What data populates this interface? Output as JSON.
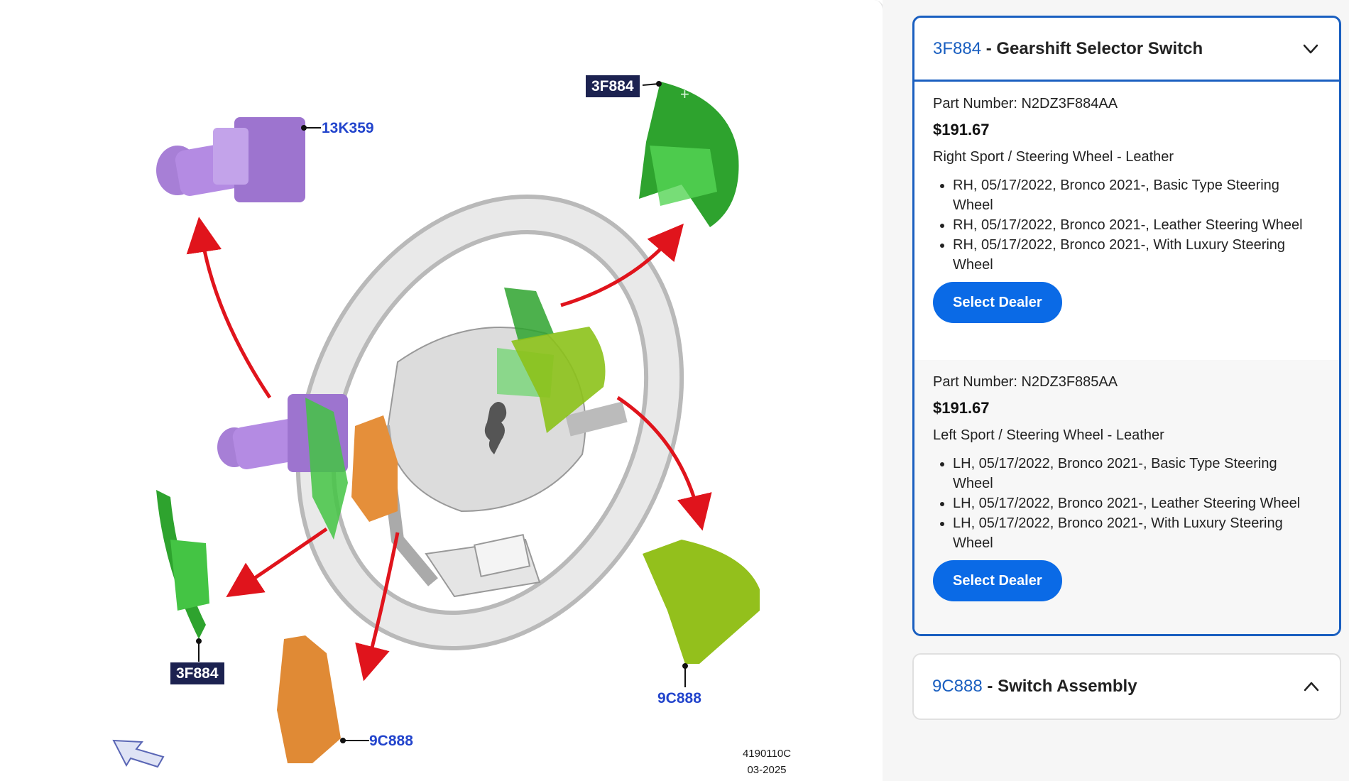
{
  "diagram": {
    "callouts": {
      "top_left_label": "13K359",
      "top_right_label": "3F884",
      "bottom_left_label": "3F884",
      "bottom_mid_label": "9C888",
      "bottom_right_label": "9C888"
    },
    "drawing_id": "4190110C",
    "drawing_date": "03-2025"
  },
  "parts_panel": {
    "expanded_section": {
      "code": "3F884",
      "separator": " - ",
      "title": "Gearshift Selector Switch",
      "parts": [
        {
          "part_number": "Part Number: N2DZ3F884AA",
          "price": "$191.67",
          "description": "Right Sport / Steering Wheel - Leather",
          "applications": [
            "RH, 05/17/2022, Bronco 2021-, Basic Type Steering Wheel",
            "RH, 05/17/2022, Bronco 2021-, Leather Steering Wheel",
            "RH, 05/17/2022, Bronco 2021-, With Luxury Steering Wheel"
          ],
          "button_label": "Select Dealer"
        },
        {
          "part_number": "Part Number: N2DZ3F885AA",
          "price": "$191.67",
          "description": "Left Sport / Steering Wheel - Leather",
          "applications": [
            "LH, 05/17/2022, Bronco 2021-, Basic Type Steering Wheel",
            "LH, 05/17/2022, Bronco 2021-, Leather Steering Wheel",
            "LH, 05/17/2022, Bronco 2021-, With Luxury Steering Wheel"
          ],
          "button_label": "Select Dealer"
        }
      ]
    },
    "collapsed_section": {
      "code": "9C888",
      "separator": " - ",
      "title": "Switch Assembly"
    }
  },
  "colors": {
    "accent_blue": "#1a5fc0",
    "button_blue": "#0a6ae6",
    "callout_navy": "#1c2250",
    "callout_text_blue": "#2244cc"
  }
}
